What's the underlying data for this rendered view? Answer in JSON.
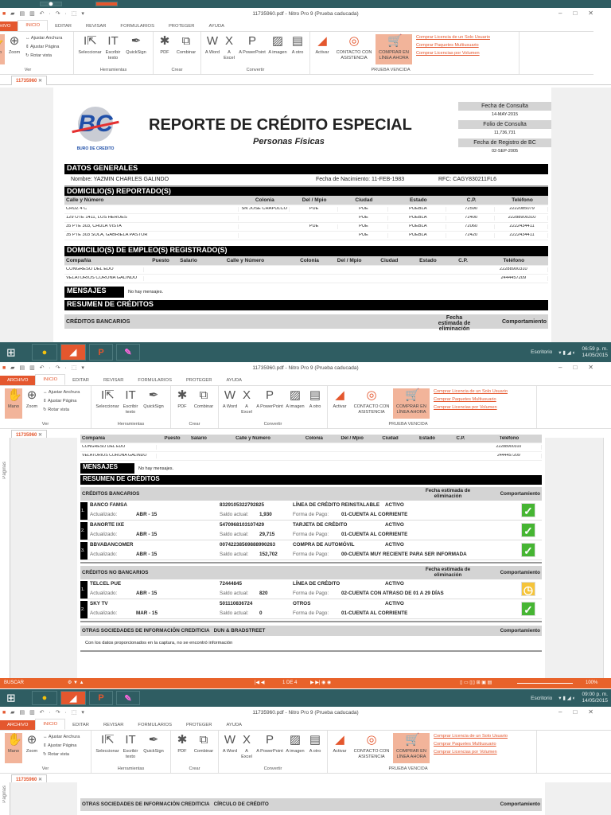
{
  "app": {
    "title": "11735960.pdf - Nitro Pro 9 (Prueba caducada)",
    "doc_tab": "11735960",
    "sidebar_label": "Páginas",
    "tabs": [
      "ARCHIVO",
      "INICIO",
      "EDITAR",
      "REVISAR",
      "FORMULARIOS",
      "PROTEGER",
      "AYUDA"
    ],
    "ribbon": {
      "mano": "Mano",
      "zoom": "Zoom",
      "ajustar_anchura": "Ajustar Anchura",
      "ajustar_pagina": "Ajustar Página",
      "rotar_vista": "Rotar vista",
      "ver": "Ver",
      "seleccionar": "Seleccionar",
      "escribir": "Escribir texto",
      "quicksign": "QuickSign",
      "herramientas": "Herramientas",
      "pdf": "PDF",
      "combinar": "Combinar",
      "crear": "Crear",
      "a_word": "A Word",
      "a_excel": "A Excel",
      "a_powerpoint": "A PowerPoint",
      "a_imagen": "A imagen",
      "a_otro": "A otro",
      "convertir": "Convertir",
      "activar": "Activar",
      "contacto": "CONTACTO CON ASISTENCIA",
      "comprar": "COMPRAR EN LÍNEA AHORA",
      "prueba_vencida": "PRUEBA VENCIDA",
      "links": [
        "Comprar Licencia de un Solo Usuario",
        "Comprar Paquetes Multiusuario",
        "Comprar Licencias por Volumen"
      ]
    }
  },
  "taskbar": {
    "escritorio": "Escritorio",
    "time_1": "06:59 p. m.",
    "date_1": "14/05/2015",
    "time_2": "09:00 p. m.",
    "date_2": "14/05/2015"
  },
  "statusbar": {
    "search": "BUSCAR",
    "page": "1 DE 4",
    "zoom": "100%"
  },
  "report": {
    "logo_text": "BURO DE CREDITO",
    "title": "REPORTE DE CRÉDITO ESPECIAL",
    "subtitle": "Personas Físicas",
    "info": [
      {
        "label": "Fecha de Consulta",
        "value": "14-MAY-2015"
      },
      {
        "label": "Folio de Consulta",
        "value": "11,736,731"
      },
      {
        "label": "Fecha de Registro de BC",
        "value": "02-SEP-2005"
      }
    ],
    "datos_generales": {
      "heading": "DATOS GENERALES",
      "nombre": "Nombre: YAZMIN CHARLES GALINDO",
      "nacimiento": "Fecha de Nacimiento: 11-FEB-1983",
      "rfc": "RFC: CAGY830211FL6"
    },
    "domicilios": {
      "heading": "DOMICILIO(S) REPORTADO(S)",
      "columns": [
        "Calle y Número",
        "Colonia",
        "Del / Mpio",
        "Ciudad",
        "Estado",
        "C.P.",
        "Teléfono"
      ],
      "rows": [
        [
          "CRUZ 4 C",
          "SN JOSE CHAPULCO",
          "PUE",
          "PUE",
          "PUEBLA",
          "72590",
          "2222085079"
        ],
        [
          "129 OTE 1411, LOS HEROES",
          "",
          "",
          "PUE",
          "PUEBLA",
          "72400",
          "22288900310"
        ],
        [
          "35 PTE 303, CHULA VISTA",
          "",
          "PUE",
          "PUE",
          "PUEBLA",
          "72060",
          "2222434411"
        ],
        [
          "35 PTE 303 SOLA, GABRIELA PASTOR",
          "",
          "",
          "PUE",
          "PUEBLA",
          "72420",
          "2222434411"
        ]
      ]
    },
    "empleos": {
      "heading": "DOMICILIO(S) DE EMPLEO(S) REGISTRADO(S)",
      "columns": [
        "Compañía",
        "Puesto",
        "Salario",
        "Calle y Número",
        "Colonia",
        "Del / Mpio",
        "Ciudad",
        "Estado",
        "C.P.",
        "Teléfono"
      ],
      "rows": [
        [
          "CONGRESO DEL EDO",
          "",
          "",
          "",
          "",
          "",
          "",
          "",
          "",
          "22288900310"
        ],
        [
          "VELATORIOS CORONA GALINDO",
          "",
          "",
          "",
          "",
          "",
          "",
          "",
          "",
          "2444457209"
        ]
      ]
    },
    "mensajes": {
      "heading": "MENSAJES",
      "text": "No hay mensajes."
    },
    "resumen": "RESUMEN DE CRÉDITOS",
    "fecha_elim": "Fecha estimada de eliminación",
    "comportamiento": "Comportamiento",
    "actualizado_label": "Actualizado:",
    "saldo_label": "Saldo actual:",
    "forma_label": "Forma de Pago:",
    "bancarios": {
      "heading": "CRÉDITOS BANCARIOS",
      "items": [
        {
          "num": "1.",
          "name": "BANCO FAMSA",
          "account": "8329105322792825",
          "type": "LÍNEA DE CRÉDITO REINSTALABLE",
          "status": "ACTIVO",
          "updated": "ABR - 15",
          "balance": "1,930",
          "payment": "01-CUENTA AL CORRIENTE",
          "behavior": "ok"
        },
        {
          "num": "2.",
          "name": "BANORTE IXE",
          "account": "5470968103107429",
          "type": "TARJETA DE CRÉDITO",
          "status": "ACTIVO",
          "updated": "ABR - 15",
          "balance": "29,715",
          "payment": "01-CUENTA AL CORRIENTE",
          "behavior": "ok"
        },
        {
          "num": "3.",
          "name": "BBVABANCOMER",
          "account": "00742238569888990263",
          "type": "COMPRA DE AUTOMÓVIL",
          "status": "ACTIVO",
          "updated": "ABR - 15",
          "balance": "152,702",
          "payment": "00-CUENTA MUY RECIENTE PARA SER INFORMADA",
          "behavior": "ok"
        }
      ]
    },
    "no_bancarios": {
      "heading": "CRÉDITOS NO BANCARIOS",
      "items": [
        {
          "num": "1.",
          "name": "TELCEL PUE",
          "account": "72444845",
          "type": "LÍNEA DE CRÉDITO",
          "status": "ACTIVO",
          "updated": "ABR - 15",
          "balance": "820",
          "payment": "02-CUENTA CON ATRASO DE 01 A 29 DÍAS",
          "behavior": "warn"
        },
        {
          "num": "2.",
          "name": "SKY TV",
          "account": "501110836724",
          "type": "OTROS",
          "status": "ACTIVO",
          "updated": "MAR - 15",
          "balance": "0",
          "payment": "01-CUENTA AL CORRIENTE",
          "behavior": "ok"
        }
      ]
    },
    "otras_dun": {
      "heading": "OTRAS SOCIEDADES DE INFORMACIÓN CREDITICIA   DUN & BRADSTREET",
      "text": "Con los datos proporcionados en la captura, no se encontró información"
    },
    "otras_circulo": {
      "heading": "OTRAS SOCIEDADES DE INFORMACIÓN CREDITICIA   CÍRCULO DE CRÉDITO"
    }
  },
  "colors": {
    "accent": "#e4572e",
    "taskbar": "#2f5d62",
    "ok": "#46b533",
    "warn": "#f5c43a"
  }
}
